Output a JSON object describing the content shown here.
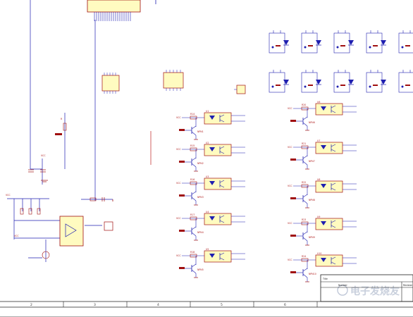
{
  "schematic": {
    "bottom_zone_numbers": [
      "2",
      "3",
      "4",
      "5",
      "6"
    ],
    "title_block": {
      "title_label": "Title",
      "number_label": "Number",
      "revision_label": "Revision"
    },
    "opto_rows_left": [
      {
        "id": "U1",
        "transistor": "NPN1",
        "resistor": "R14"
      },
      {
        "id": "U2",
        "transistor": "NPN2",
        "resistor": "R15"
      },
      {
        "id": "U3",
        "transistor": "NPN3",
        "resistor": "R16"
      },
      {
        "id": "U4",
        "transistor": "NPN4",
        "resistor": "R17"
      },
      {
        "id": "U5",
        "transistor": "NPN5",
        "resistor": "R18"
      }
    ],
    "opto_rows_right": [
      {
        "id": "U6",
        "transistor": "NPN6",
        "resistor": "R20"
      },
      {
        "id": "U7",
        "transistor": "NPN7",
        "resistor": "R21"
      },
      {
        "id": "U8",
        "transistor": "NPN8",
        "resistor": "R22"
      },
      {
        "id": "U9",
        "transistor": "NPN9",
        "resistor": "R23"
      },
      {
        "id": "U10",
        "transistor": "NPN10",
        "resistor": "R24"
      }
    ],
    "vcc_label": "VCC",
    "watermark": "电子发烧友"
  },
  "colors": {
    "wire": "#1f1fb0",
    "component": "#a01010",
    "label": "#b02020",
    "chip_fill": "#fffbc0",
    "ground": "#a01010"
  }
}
